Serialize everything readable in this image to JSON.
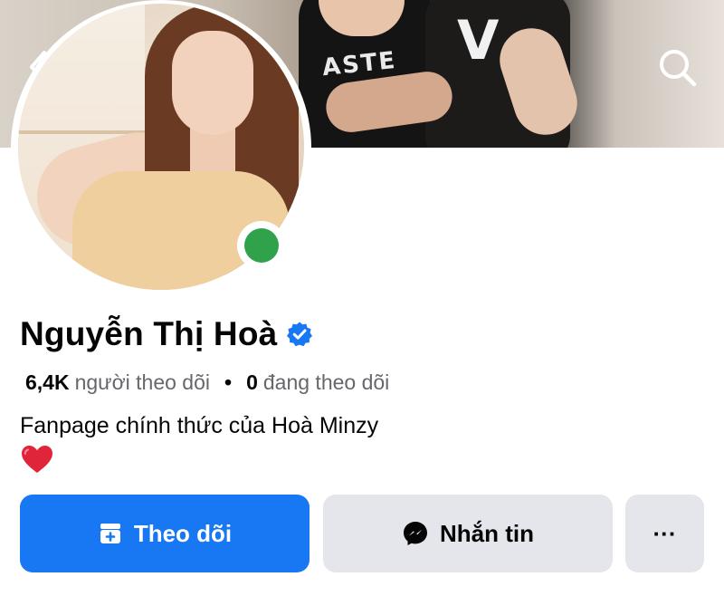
{
  "profile": {
    "name": "Nguyễn Thị Hoà",
    "verified": true,
    "followers_count": "6,4K",
    "followers_label": "người theo dõi",
    "separator": "•",
    "following_count": "0",
    "following_label": "đang theo dõi",
    "bio": "Fanpage chính thức của Hoà Minzy",
    "bio_emoji": "heart-emoji",
    "online": true
  },
  "actions": {
    "follow_label": "Theo dõi",
    "message_label": "Nhắn tin",
    "more_label": "···"
  },
  "icons": {
    "back": "chevron-left-icon",
    "search": "search-icon",
    "follow": "follow-icon",
    "messenger": "messenger-icon",
    "verified": "verified-badge-icon"
  },
  "colors": {
    "primary": "#1877f2",
    "secondary_button": "#e4e6eb",
    "online": "#31a24c",
    "verified": "#1877f2",
    "muted_text": "#65676b"
  }
}
